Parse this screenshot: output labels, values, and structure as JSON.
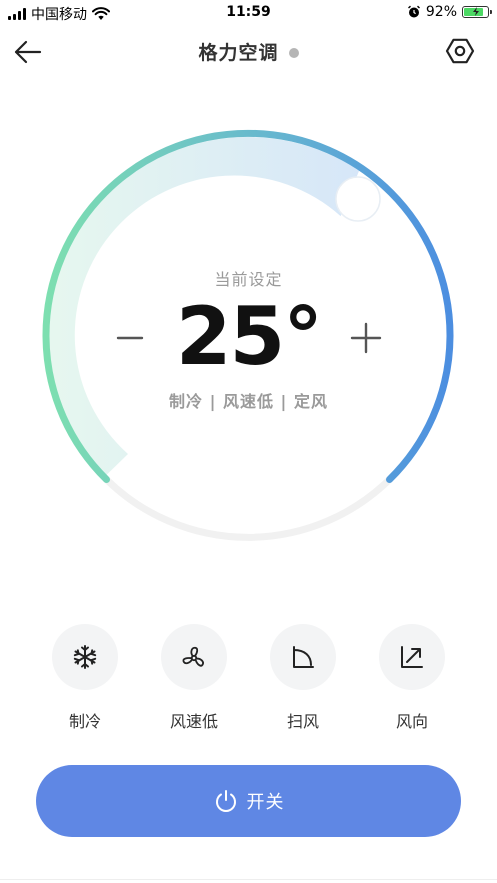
{
  "status_bar": {
    "carrier": "中国移动",
    "time": "11:59",
    "battery": "92%",
    "battery_level": 0.92
  },
  "header": {
    "title": "格力空调"
  },
  "dial": {
    "label": "当前设定",
    "temperature": "25°",
    "mode_summary": "制冷 | 风速低 | 定风"
  },
  "controls": [
    {
      "label": "制冷",
      "icon": "snowflake-icon"
    },
    {
      "label": "风速低",
      "icon": "fan-icon"
    },
    {
      "label": "扫风",
      "icon": "sweep-icon"
    },
    {
      "label": "风向",
      "icon": "direction-arrow-icon"
    }
  ],
  "power": {
    "label": "开关",
    "icon": "power-icon"
  },
  "colors": {
    "accent": "#5f87e4",
    "gradient_start": "#7ddfb0",
    "gradient_end": "#4c8ee0",
    "track": "#f1f1f1"
  }
}
